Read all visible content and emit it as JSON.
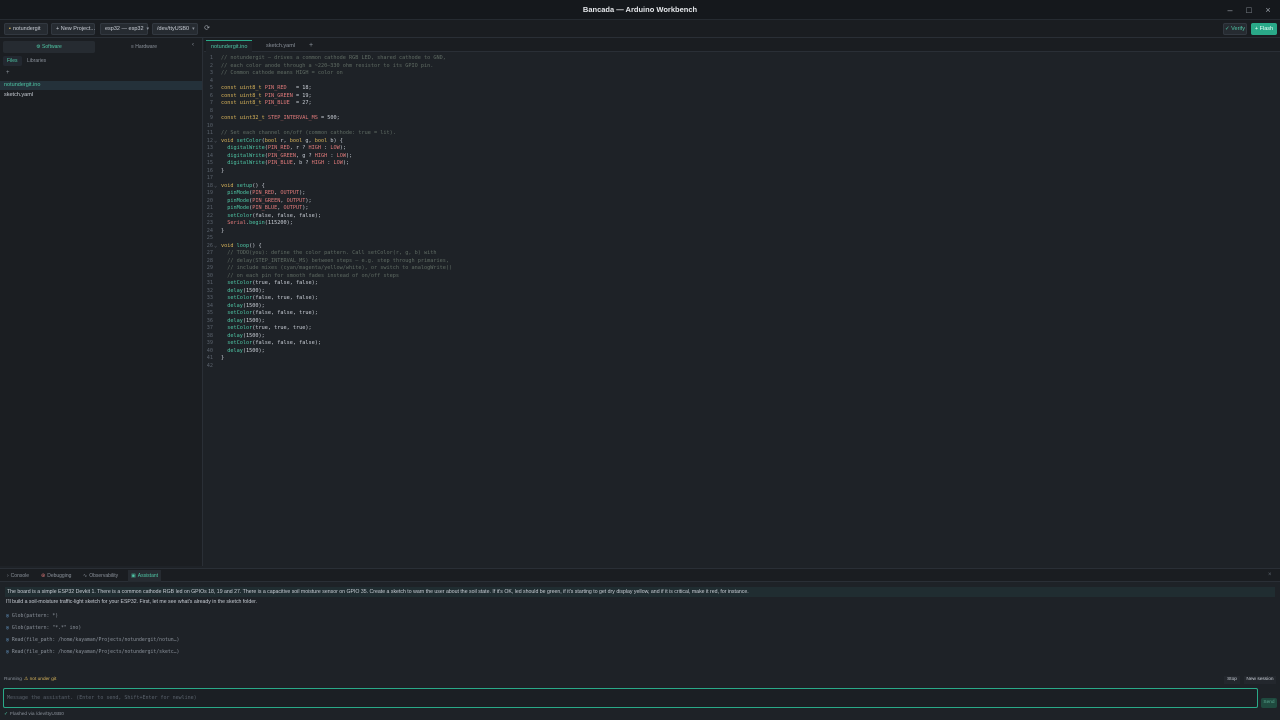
{
  "window": {
    "title": "Bancada — Arduino Workbench",
    "controls": [
      "–",
      "□",
      "×"
    ]
  },
  "toolbar": {
    "project": "notundergit",
    "new_project": "+ New Project...",
    "board": "esp32 — esp32",
    "port": "/dev/ttyUSB0",
    "refresh_icon": "⟳",
    "verify": "✓ Verify",
    "flash": "+ Flash"
  },
  "sidebar": {
    "mode_tabs": [
      "⚙ Software",
      "≡ Hardware"
    ],
    "collapse_icon": "‹",
    "sub_tabs": [
      "Files",
      "Libraries"
    ],
    "new_file_icon": "+",
    "files": [
      "notundergit.ino",
      "sketch.yaml"
    ],
    "active_file_index": 0
  },
  "editor": {
    "tabs": [
      "notundergit.ino",
      "sketch.yaml"
    ],
    "add_tab": "+",
    "lines": [
      [
        [
          "cm",
          "// notundergit — drives a common cathode RGB LED, shared cathode to GND,"
        ]
      ],
      [
        [
          "cm",
          "// each color anode through a ~220–330 ohm resistor to its GPIO pin."
        ]
      ],
      [
        [
          "cm",
          "// Common cathode means HIGH = color on"
        ]
      ],
      [],
      [
        [
          "kw",
          "const"
        ],
        [
          "pl",
          " "
        ],
        [
          "kw",
          "uint8_t"
        ],
        [
          "pl",
          " "
        ],
        [
          "id",
          "PIN_RED"
        ],
        [
          "pl",
          "   = 18;"
        ]
      ],
      [
        [
          "kw",
          "const"
        ],
        [
          "pl",
          " "
        ],
        [
          "kw",
          "uint8_t"
        ],
        [
          "pl",
          " "
        ],
        [
          "id",
          "PIN_GREEN"
        ],
        [
          "pl",
          " = 19;"
        ]
      ],
      [
        [
          "kw",
          "const"
        ],
        [
          "pl",
          " "
        ],
        [
          "kw",
          "uint8_t"
        ],
        [
          "pl",
          " "
        ],
        [
          "id",
          "PIN_BLUE"
        ],
        [
          "pl",
          "  = 27;"
        ]
      ],
      [],
      [
        [
          "kw",
          "const"
        ],
        [
          "pl",
          " "
        ],
        [
          "kw",
          "uint32_t"
        ],
        [
          "pl",
          " "
        ],
        [
          "id",
          "STEP_INTERVAL_MS"
        ],
        [
          "pl",
          " = 500;"
        ]
      ],
      [],
      [
        [
          "cm",
          "// Set each channel on/off (common cathode: true = lit)."
        ]
      ],
      [
        [
          "kw",
          "void"
        ],
        [
          "pl",
          " "
        ],
        [
          "fn",
          "setColor"
        ],
        [
          "pl",
          "("
        ],
        [
          "kw",
          "bool"
        ],
        [
          "pl",
          " r, "
        ],
        [
          "kw",
          "bool"
        ],
        [
          "pl",
          " g, "
        ],
        [
          "kw",
          "bool"
        ],
        [
          "pl",
          " b) {"
        ]
      ],
      [
        [
          "pl",
          "  "
        ],
        [
          "fn",
          "digitalWrite"
        ],
        [
          "pl",
          "("
        ],
        [
          "id",
          "PIN_RED"
        ],
        [
          "pl",
          ", r ? "
        ],
        [
          "id",
          "HIGH"
        ],
        [
          "pl",
          " : "
        ],
        [
          "id",
          "LOW"
        ],
        [
          "pl",
          ");"
        ]
      ],
      [
        [
          "pl",
          "  "
        ],
        [
          "fn",
          "digitalWrite"
        ],
        [
          "pl",
          "("
        ],
        [
          "id",
          "PIN_GREEN"
        ],
        [
          "pl",
          ", g ? "
        ],
        [
          "id",
          "HIGH"
        ],
        [
          "pl",
          " : "
        ],
        [
          "id",
          "LOW"
        ],
        [
          "pl",
          ");"
        ]
      ],
      [
        [
          "pl",
          "  "
        ],
        [
          "fn",
          "digitalWrite"
        ],
        [
          "pl",
          "("
        ],
        [
          "id",
          "PIN_BLUE"
        ],
        [
          "pl",
          ", b ? "
        ],
        [
          "id",
          "HIGH"
        ],
        [
          "pl",
          " : "
        ],
        [
          "id",
          "LOW"
        ],
        [
          "pl",
          ");"
        ]
      ],
      [
        [
          "pl",
          "}"
        ]
      ],
      [],
      [
        [
          "kw",
          "void"
        ],
        [
          "pl",
          " "
        ],
        [
          "fn",
          "setup"
        ],
        [
          "pl",
          "() {"
        ]
      ],
      [
        [
          "pl",
          "  "
        ],
        [
          "fn",
          "pinMode"
        ],
        [
          "pl",
          "("
        ],
        [
          "id",
          "PIN_RED"
        ],
        [
          "pl",
          ", "
        ],
        [
          "id",
          "OUTPUT"
        ],
        [
          "pl",
          ");"
        ]
      ],
      [
        [
          "pl",
          "  "
        ],
        [
          "fn",
          "pinMode"
        ],
        [
          "pl",
          "("
        ],
        [
          "id",
          "PIN_GREEN"
        ],
        [
          "pl",
          ", "
        ],
        [
          "id",
          "OUTPUT"
        ],
        [
          "pl",
          ");"
        ]
      ],
      [
        [
          "pl",
          "  "
        ],
        [
          "fn",
          "pinMode"
        ],
        [
          "pl",
          "("
        ],
        [
          "id",
          "PIN_BLUE"
        ],
        [
          "pl",
          ", "
        ],
        [
          "id",
          "OUTPUT"
        ],
        [
          "pl",
          ");"
        ]
      ],
      [
        [
          "pl",
          "  "
        ],
        [
          "fn",
          "setColor"
        ],
        [
          "pl",
          "(false, false, false);"
        ]
      ],
      [
        [
          "pl",
          "  "
        ],
        [
          "id",
          "Serial"
        ],
        [
          "pl",
          "."
        ],
        [
          "fn",
          "begin"
        ],
        [
          "pl",
          "(115200);"
        ]
      ],
      [
        [
          "pl",
          "}"
        ]
      ],
      [],
      [
        [
          "kw",
          "void"
        ],
        [
          "pl",
          " "
        ],
        [
          "fn",
          "loop"
        ],
        [
          "pl",
          "() {"
        ]
      ],
      [
        [
          "pl",
          "  "
        ],
        [
          "cm",
          "// TODO(you): define the color pattern. Call setColor(r, g, b) with"
        ]
      ],
      [
        [
          "pl",
          "  "
        ],
        [
          "cm",
          "// delay(STEP_INTERVAL_MS) between steps — e.g. step through primaries,"
        ]
      ],
      [
        [
          "pl",
          "  "
        ],
        [
          "cm",
          "// include mixes (cyan/magenta/yellow/white), or switch to analogWrite()"
        ]
      ],
      [
        [
          "pl",
          "  "
        ],
        [
          "cm",
          "// on each pin for smooth fades instead of on/off steps"
        ]
      ],
      [
        [
          "pl",
          "  "
        ],
        [
          "fn",
          "setColor"
        ],
        [
          "pl",
          "(true, false, false);"
        ]
      ],
      [
        [
          "pl",
          "  "
        ],
        [
          "fn",
          "delay"
        ],
        [
          "pl",
          "(1500);"
        ]
      ],
      [
        [
          "pl",
          "  "
        ],
        [
          "fn",
          "setColor"
        ],
        [
          "pl",
          "(false, true, false);"
        ]
      ],
      [
        [
          "pl",
          "  "
        ],
        [
          "fn",
          "delay"
        ],
        [
          "pl",
          "(1500);"
        ]
      ],
      [
        [
          "pl",
          "  "
        ],
        [
          "fn",
          "setColor"
        ],
        [
          "pl",
          "(false, false, true);"
        ]
      ],
      [
        [
          "pl",
          "  "
        ],
        [
          "fn",
          "delay"
        ],
        [
          "pl",
          "(1500);"
        ]
      ],
      [
        [
          "pl",
          "  "
        ],
        [
          "fn",
          "setColor"
        ],
        [
          "pl",
          "(true, true, true);"
        ]
      ],
      [
        [
          "pl",
          "  "
        ],
        [
          "fn",
          "delay"
        ],
        [
          "pl",
          "(1500);"
        ]
      ],
      [
        [
          "pl",
          "  "
        ],
        [
          "fn",
          "setColor"
        ],
        [
          "pl",
          "(false, false, false);"
        ]
      ],
      [
        [
          "pl",
          "  "
        ],
        [
          "fn",
          "delay"
        ],
        [
          "pl",
          "(1500);"
        ]
      ],
      [
        [
          "pl",
          "}"
        ]
      ],
      []
    ],
    "fold_lines": [
      12,
      18,
      26
    ]
  },
  "panel": {
    "tabs": [
      {
        "icon": "›",
        "label": "Console"
      },
      {
        "icon": "⊛",
        "label": "Debugging"
      },
      {
        "icon": "∿",
        "label": "Observability"
      },
      {
        "icon": "▣",
        "label": "Assistant"
      }
    ],
    "active_tab": 3,
    "close_icon": "×"
  },
  "chat": {
    "user_message": "The board is a simple ESP32 Devkit 1. There is a common cathode RGB led on GPIOs 18, 19 and 27. There is a capacitive soil moisture sensor on GPIO 35. Create a sketch to warn the user about the soil state. If it's OK, led should be green, if it's starting to get dry display yellow, and if it is critical, make it red, for instance.",
    "assistant_message": "I'll build a soil-moisture traffic-light sketch for your ESP32. First, let me see what's already in the sketch folder.",
    "tool_calls": [
      "Glob(pattern: *)",
      "Glob(pattern: \"*.*\" ino)",
      "Read(file_path: /home/kayaman/Projects/notundergit/notun…)",
      "Read(file_path: /home/kayaman/Projects/notundergit/sketc…)"
    ],
    "tool_icon": "🔍",
    "status": "Running",
    "git_warning": "⚠ not under git",
    "stop": "Stop",
    "new_session": "New session",
    "input_placeholder": "Message the assistant. (Enter to send, Shift+Enter for newline)",
    "send": "Send"
  },
  "footer": {
    "icon": "✓",
    "status": "Flashed via /dev/ttyUSB0"
  },
  "colors": {
    "accent": "#2aa988",
    "background": "#1e2227",
    "comment": "#5f6b63",
    "keyword": "#d9b45a",
    "identifier": "#e07a7a",
    "function": "#4fc7a6"
  }
}
